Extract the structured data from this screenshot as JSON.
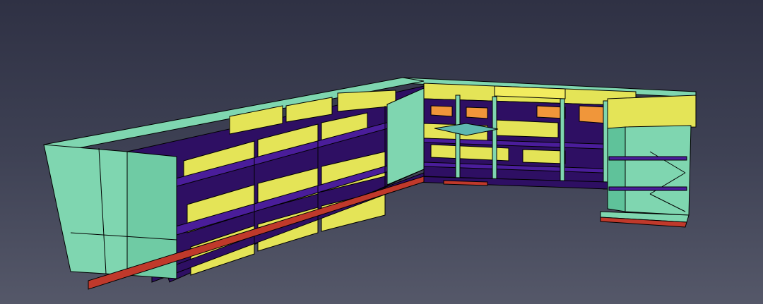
{
  "viewer": {
    "background_top": "#2f3144",
    "background_bottom": "#545768"
  },
  "model": {
    "colors": {
      "exterior_wall": "#7fd6b0",
      "interior_panel": "#e4e457",
      "floor_slab": "#2e0f63",
      "foundation": "#c0392b",
      "orange_panel": "#f0963a",
      "canopy": "#5fb8b0",
      "edge_line": "#000000"
    }
  }
}
